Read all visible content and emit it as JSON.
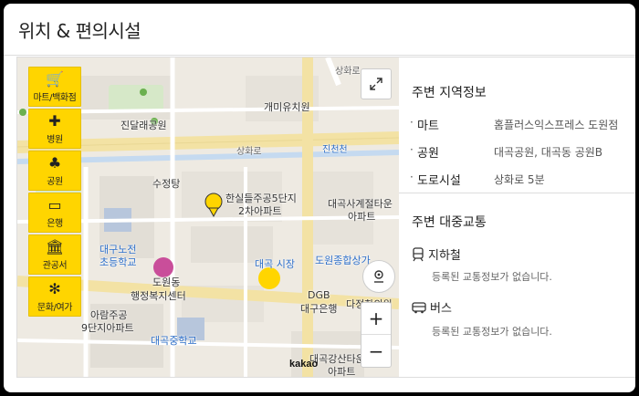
{
  "section": {
    "title": "위치 & 편의시설"
  },
  "categories": [
    {
      "label": "마트/백화점",
      "icon": "cart-icon",
      "glyph": "🛒"
    },
    {
      "label": "병원",
      "icon": "hospital-icon",
      "glyph": "✚"
    },
    {
      "label": "공원",
      "icon": "park-icon",
      "glyph": "♣"
    },
    {
      "label": "은행",
      "icon": "bank-card-icon",
      "glyph": "▭"
    },
    {
      "label": "관공서",
      "icon": "government-building-icon",
      "glyph": "🏛"
    },
    {
      "label": "문화/여가",
      "icon": "ferris-wheel-icon",
      "glyph": "✻"
    }
  ],
  "map": {
    "labels": {
      "road_top": "상화로",
      "road_mid": "상화로",
      "stream": "진천천",
      "kindergarten": "개미유치원",
      "park": "진달래공원",
      "apt1": "수정탕",
      "apt2_l1": "한실들주공5단지",
      "apt2_l2": "2차아파트",
      "apt3_l1": "대곡사계절타운",
      "apt3_l2": "아파트",
      "school1_l1": "대구노전",
      "school1_l2": "초등학교",
      "office_l1": "도원동",
      "office_l2": "행정복지센터",
      "market": "대곡 시장",
      "mall": "도원종합상가",
      "bank_l1": "DGB",
      "bank_l2": "대구은행",
      "clinic": "다정한의원",
      "apt4_l1": "아람주공",
      "apt4_l2": "9단지아파트",
      "school2": "대곡중학교",
      "apt5_l1": "대곡강산타운",
      "apt5_l2": "아파트",
      "logo": "kakao"
    },
    "controls": {
      "zoom_in": "+",
      "zoom_out": "−"
    }
  },
  "panel": {
    "region_title": "주변 지역정보",
    "items": [
      {
        "key": "마트",
        "value": "홈플러스익스프레스 도원점"
      },
      {
        "key": "공원",
        "value": "대곡공원, 대곡동 공원B"
      },
      {
        "key": "도로시설",
        "value": "상화로 5분"
      }
    ],
    "transit_title": "주변 대중교통",
    "subway": {
      "label": "지하철",
      "empty": "등록된 교통정보가 없습니다."
    },
    "bus": {
      "label": "버스",
      "empty": "등록된 교통정보가 없습니다."
    }
  }
}
